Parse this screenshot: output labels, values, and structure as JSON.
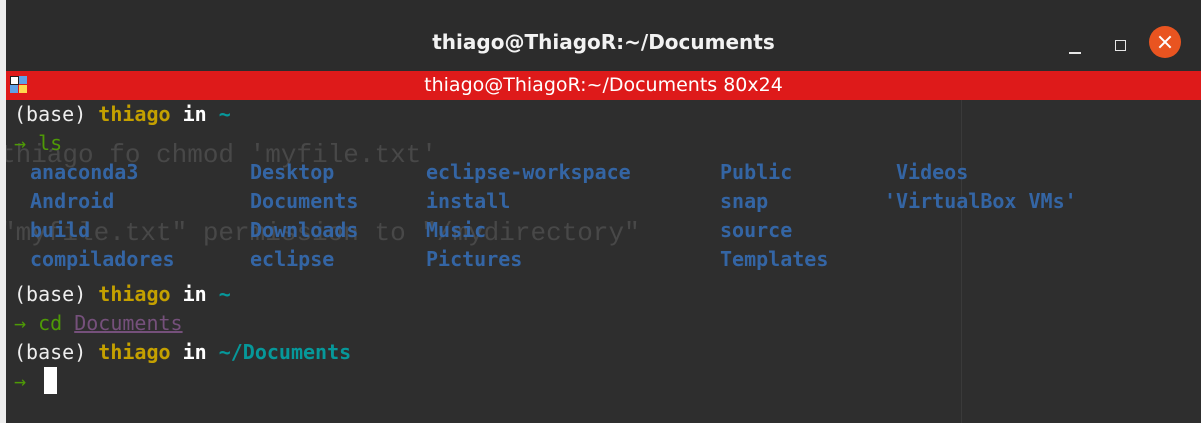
{
  "window": {
    "title": "thiago@ThiagoR:~/Documents",
    "subtitle": "thiago@ThiagoR:~/Documents 80x24",
    "accent_color": "#de1a1a",
    "close_color": "#e95420"
  },
  "terminal": {
    "lines": [
      {
        "env": "(base) ",
        "user": "thiago",
        "in": " in ",
        "path": "~"
      },
      {
        "arrow": "→",
        "cmd": " ls"
      },
      {
        "env": "(base) ",
        "user": "thiago",
        "in": " in ",
        "path": "~"
      },
      {
        "arrow": "→",
        "cmd": " cd ",
        "arg": "Documents"
      },
      {
        "env": "(base) ",
        "user": "thiago",
        "in": " in ",
        "path": "~/Documents"
      },
      {
        "arrow": "→"
      }
    ],
    "ls_output": [
      [
        "anaconda3",
        "Desktop",
        "eclipse-workspace",
        "Public",
        "Videos"
      ],
      [
        "Android",
        "Documents",
        "install",
        "snap",
        "'VirtualBox VMs'"
      ],
      [
        "build",
        "Downloads",
        "Music",
        "source",
        ""
      ],
      [
        "compiladores",
        "eclipse",
        "Pictures",
        "Templates",
        ""
      ]
    ]
  }
}
